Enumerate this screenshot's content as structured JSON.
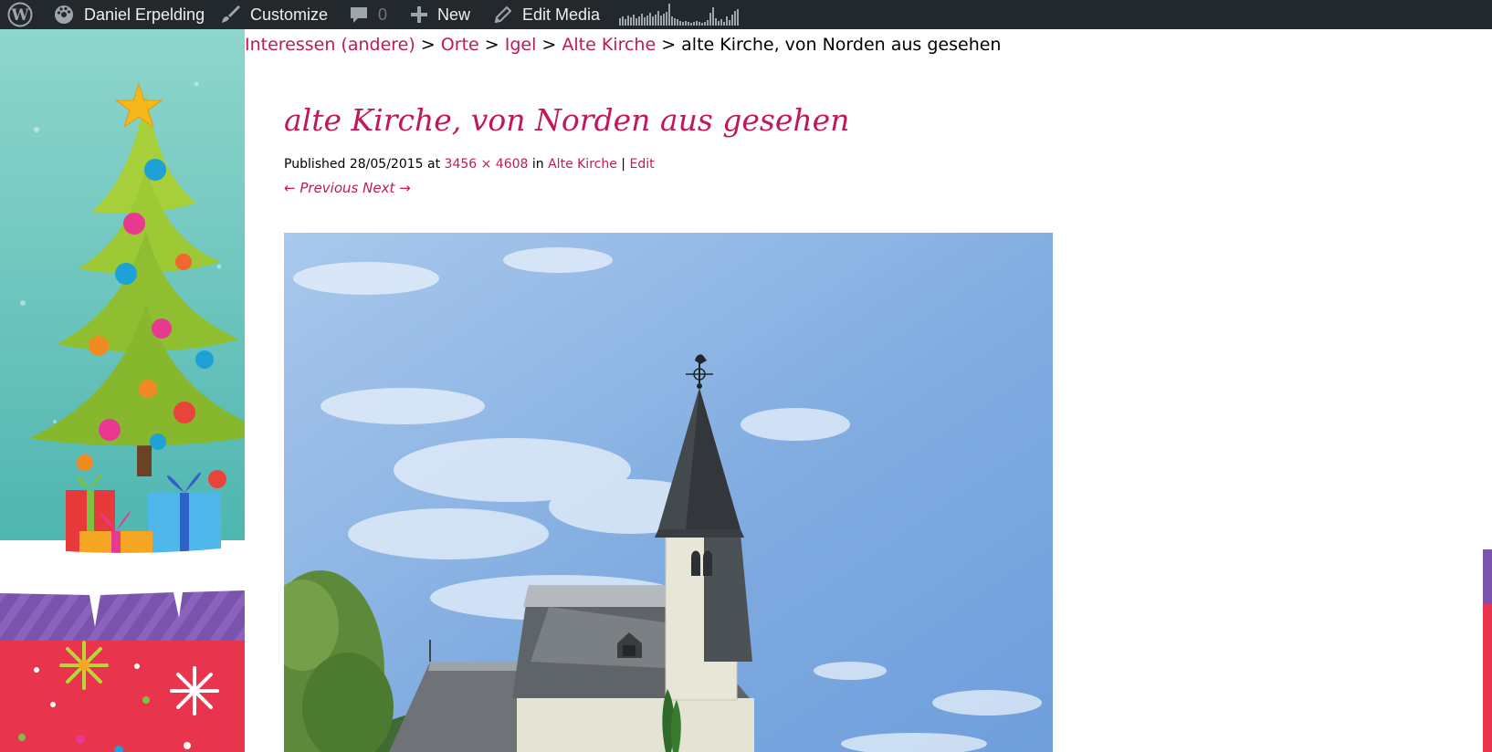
{
  "admin_bar": {
    "logo_icon": "wordpress-logo-icon",
    "user_label": "Daniel Erpelding",
    "user_icon": "dashboard-icon",
    "customize_label": "Customize",
    "customize_icon": "paintbrush-icon",
    "comments_count": "0",
    "comments_icon": "comment-icon",
    "new_label": "New",
    "new_icon": "plus-icon",
    "edit_media_label": "Edit Media",
    "edit_media_icon": "pencil-icon",
    "stats_icon": "stats-sparkline-icon",
    "colors": {
      "background": "#23282d",
      "text": "#eeeeee"
    }
  },
  "breadcrumb": {
    "items": [
      {
        "label": "Interessen (andere)"
      },
      {
        "label": "Orte"
      },
      {
        "label": "Igel"
      },
      {
        "label": "Alte Kirche"
      }
    ],
    "separator": ">",
    "current": "alte Kirche, von Norden aus gesehen"
  },
  "attachment": {
    "title": "alte Kirche, von Norden aus gesehen",
    "published_prefix": "Published",
    "date": "28/05/2015",
    "at_word": "at",
    "dimensions": "3456 × 4608",
    "in_word": "in",
    "parent": "Alte Kirche",
    "divider": "|",
    "edit_label": "Edit",
    "previous_label": "Previous",
    "next_label": "Next",
    "image_subject": "church-photo"
  },
  "theme": {
    "accent": "#c2185b",
    "background_art": "christmas-tree-gifts-background"
  }
}
